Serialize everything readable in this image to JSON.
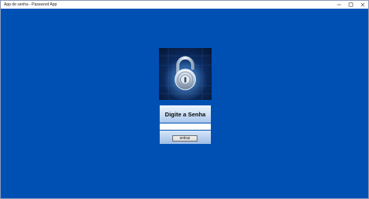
{
  "window": {
    "title": "App de senha - Password App",
    "controls": {
      "minimize_icon": "minimize-icon",
      "maximize_icon": "maximize-icon",
      "close_icon": "close-icon"
    }
  },
  "main": {
    "lock_image_icon": "padlock-icon",
    "prompt_label": "Digite a Senha",
    "password_value": "",
    "enter_button_label": "entrar"
  },
  "colors": {
    "background": "#0050b4",
    "titlebar": "#ffffff",
    "prompt_panel": "#c9ddf5"
  }
}
